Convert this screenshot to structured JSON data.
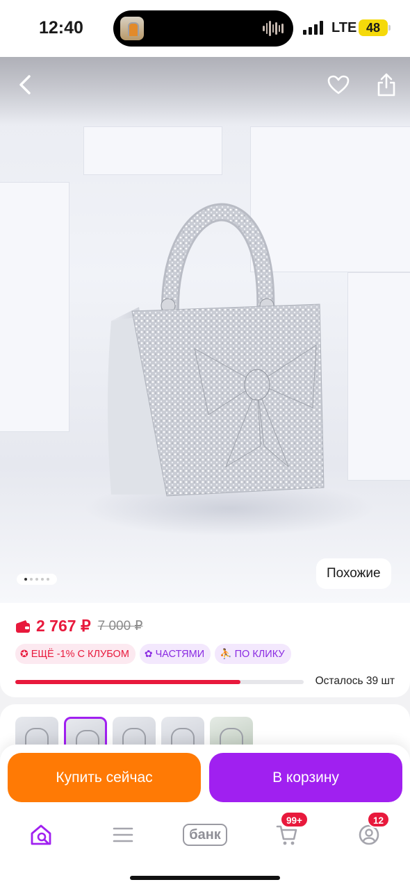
{
  "status_bar": {
    "time": "12:40",
    "network": "LTE",
    "battery": "48"
  },
  "product": {
    "similar_label": "Похожие",
    "price": "2 767 ₽",
    "old_price": "7 000 ₽",
    "tags": [
      {
        "label": "ЕЩЁ -1% С КЛУБОМ",
        "icon": "star-badge-icon"
      },
      {
        "label": "ЧАСТЯМИ",
        "icon": "flower-icon"
      },
      {
        "label": "ПО КЛИКУ",
        "icon": "running-man-icon"
      }
    ],
    "stock_label": "Осталось 39 шт",
    "stock_progress": 0.78,
    "image_count": 5,
    "current_image": 1
  },
  "actions": {
    "buy_now": "Купить сейчас",
    "add_to_cart": "В корзину"
  },
  "bottom_nav": {
    "items": [
      "home-search-icon",
      "catalog-menu-icon",
      "bank-icon",
      "cart-icon",
      "profile-icon"
    ],
    "bank_label": "банк",
    "cart_badge": "99+",
    "profile_badge": "12"
  },
  "colors": {
    "accent_red": "#e8193c",
    "purple": "#a020f0",
    "orange": "#ff7a05"
  }
}
